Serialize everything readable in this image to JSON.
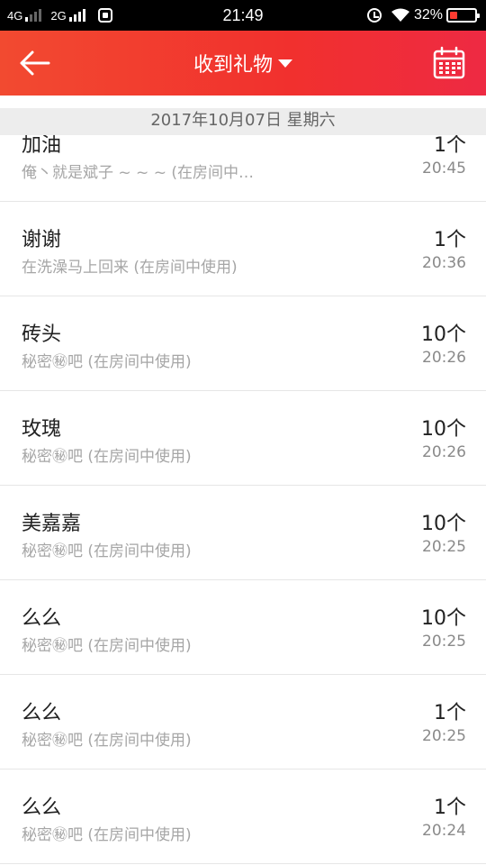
{
  "status_bar": {
    "network1": "4G",
    "network2": "2G",
    "time": "21:49",
    "battery_pct": "32%",
    "battery_level": 0.32
  },
  "header": {
    "title": "收到礼物",
    "accent_color": "#f1302e"
  },
  "date_header": "2017年10月07日 星期六",
  "gifts": [
    {
      "name": "加油",
      "desc": "俺丶就是斌子 ~ ~ ~ (在房间中…",
      "count": "1个",
      "time": "20:45"
    },
    {
      "name": "谢谢",
      "desc": "在洗澡马上回来 (在房间中使用)",
      "count": "1个",
      "time": "20:36"
    },
    {
      "name": "砖头",
      "desc": "秘密㊙吧 (在房间中使用)",
      "count": "10个",
      "time": "20:26"
    },
    {
      "name": "玫瑰",
      "desc": "秘密㊙吧 (在房间中使用)",
      "count": "10个",
      "time": "20:26"
    },
    {
      "name": "美嘉嘉",
      "desc": "秘密㊙吧 (在房间中使用)",
      "count": "10个",
      "time": "20:25"
    },
    {
      "name": "么么",
      "desc": "秘密㊙吧 (在房间中使用)",
      "count": "10个",
      "time": "20:25"
    },
    {
      "name": "么么",
      "desc": "秘密㊙吧 (在房间中使用)",
      "count": "1个",
      "time": "20:25"
    },
    {
      "name": "么么",
      "desc": "秘密㊙吧 (在房间中使用)",
      "count": "1个",
      "time": "20:24"
    }
  ]
}
